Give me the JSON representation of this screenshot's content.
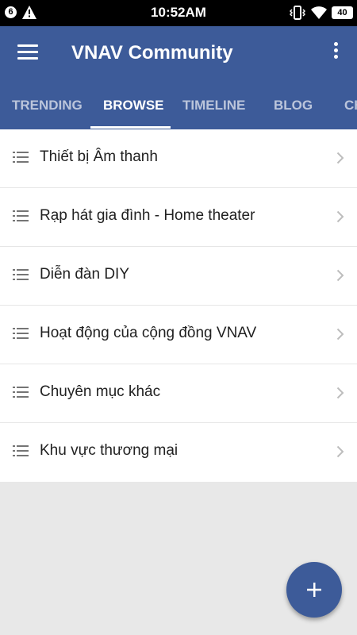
{
  "statusbar": {
    "notification_count": "6",
    "time": "10:52AM",
    "battery": "40",
    "icons": [
      "warning-icon",
      "vibrate-icon",
      "wifi-icon",
      "battery-icon"
    ]
  },
  "appbar": {
    "title": "VNAV Community",
    "menu_icon": "hamburger-menu-icon",
    "overflow_icon": "more-vertical-icon",
    "color": "#3d5b99"
  },
  "tabs": [
    {
      "label": "TRENDING",
      "active": false
    },
    {
      "label": "BROWSE",
      "active": true
    },
    {
      "label": "TIMELINE",
      "active": false
    },
    {
      "label": "BLOG",
      "active": false
    },
    {
      "label": "CH",
      "active": false
    }
  ],
  "categories": [
    {
      "label": "Thiết bị Âm thanh"
    },
    {
      "label": "Rạp hát gia đình - Home theater"
    },
    {
      "label": "Diễn đàn DIY"
    },
    {
      "label": "Hoạt động của cộng đồng VNAV"
    },
    {
      "label": "Chuyên mục khác"
    },
    {
      "label": "Khu vực thương mại"
    }
  ],
  "fab": {
    "icon": "plus-icon"
  }
}
